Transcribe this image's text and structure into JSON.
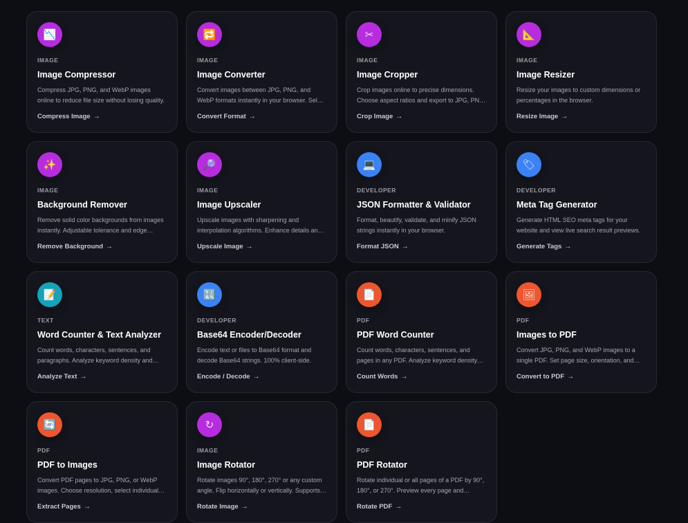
{
  "tools": [
    {
      "category": "IMAGE",
      "title": "Image Compressor",
      "description": "Compress JPG, PNG, and WebP images online to reduce file size without losing quality.",
      "action": "Compress Image",
      "icon": "chart-down-icon",
      "glyph": "📉",
      "color": "#b82ce0"
    },
    {
      "category": "IMAGE",
      "title": "Image Converter",
      "description": "Convert images between JPG, PNG, and WebP formats instantly in your browser. Select format and download.",
      "action": "Convert Format",
      "icon": "repeat-icon",
      "glyph": "🔁",
      "color": "#b82ce0"
    },
    {
      "category": "IMAGE",
      "title": "Image Cropper",
      "description": "Crop images online to precise dimensions. Choose aspect ratios and export to JPG, PNG, or WebP.",
      "action": "Crop Image",
      "icon": "scissors-icon",
      "glyph": "✂",
      "color": "#b82ce0"
    },
    {
      "category": "IMAGE",
      "title": "Image Resizer",
      "description": "Resize your images to custom dimensions or percentages in the browser.",
      "action": "Resize Image",
      "icon": "triangle-ruler-icon",
      "glyph": "📐",
      "color": "#b82ce0"
    },
    {
      "category": "IMAGE",
      "title": "Background Remover",
      "description": "Remove solid color backgrounds from images instantly. Adjustable tolerance and edge smoothing.",
      "action": "Remove Background",
      "icon": "sparkles-icon",
      "glyph": "✨",
      "color": "#b82ce0"
    },
    {
      "category": "IMAGE",
      "title": "Image Upscaler",
      "description": "Upscale images with sharpening and interpolation algorithms. Enhance details and quality.",
      "action": "Upscale Image",
      "icon": "magnifier-icon",
      "glyph": "🔎",
      "color": "#b82ce0"
    },
    {
      "category": "DEVELOPER",
      "title": "JSON Formatter & Validator",
      "description": "Format, beautify, validate, and minify JSON strings instantly in your browser.",
      "action": "Format JSON",
      "icon": "laptop-icon",
      "glyph": "💻",
      "color": "#3b82f6"
    },
    {
      "category": "DEVELOPER",
      "title": "Meta Tag Generator",
      "description": "Generate HTML SEO meta tags for your website and view live search result previews.",
      "action": "Generate Tags",
      "icon": "tag-icon",
      "glyph": "🏷",
      "color": "#3b82f6"
    },
    {
      "category": "TEXT",
      "title": "Word Counter & Text Analyzer",
      "description": "Count words, characters, sentences, and paragraphs. Analyze keyword density and reading time.",
      "action": "Analyze Text",
      "icon": "memo-icon",
      "glyph": "📝",
      "color": "#14a3b8"
    },
    {
      "category": "DEVELOPER",
      "title": "Base64 Encoder/Decoder",
      "description": "Encode text or files to Base64 format and decode Base64 strings. 100% client-side.",
      "action": "Encode / Decode",
      "icon": "symbols-icon",
      "glyph": "🔣",
      "color": "#3b82f6"
    },
    {
      "category": "PDF",
      "title": "PDF Word Counter",
      "description": "Count words, characters, sentences, and pages in any PDF. Analyze keyword density and more.",
      "action": "Count Words",
      "icon": "document-icon",
      "glyph": "📄",
      "color": "#f0562e"
    },
    {
      "category": "PDF",
      "title": "Images to PDF",
      "description": "Convert JPG, PNG, and WebP images to a single PDF. Set page size, orientation, and margins.",
      "action": "Convert to PDF",
      "icon": "picture-icon",
      "glyph": "🖼",
      "color": "#f0562e"
    },
    {
      "category": "PDF",
      "title": "PDF to Images",
      "description": "Convert PDF pages to JPG, PNG, or WebP images. Choose resolution, select individual pages.",
      "action": "Extract Pages",
      "icon": "refresh-icon",
      "glyph": "🔄",
      "color": "#f0562e"
    },
    {
      "category": "IMAGE",
      "title": "Image Rotator",
      "description": "Rotate images 90°, 180°, 270° or any custom angle. Flip horizontally or vertically. Supports batch.",
      "action": "Rotate Image",
      "icon": "rotate-icon",
      "glyph": "↻",
      "color": "#b82ce0"
    },
    {
      "category": "PDF",
      "title": "PDF Rotator",
      "description": "Rotate individual or all pages of a PDF by 90°, 180°, or 270°. Preview every page and download.",
      "action": "Rotate PDF",
      "icon": "document-icon",
      "glyph": "📄",
      "color": "#f0562e"
    }
  ],
  "arrow_glyph": "→"
}
